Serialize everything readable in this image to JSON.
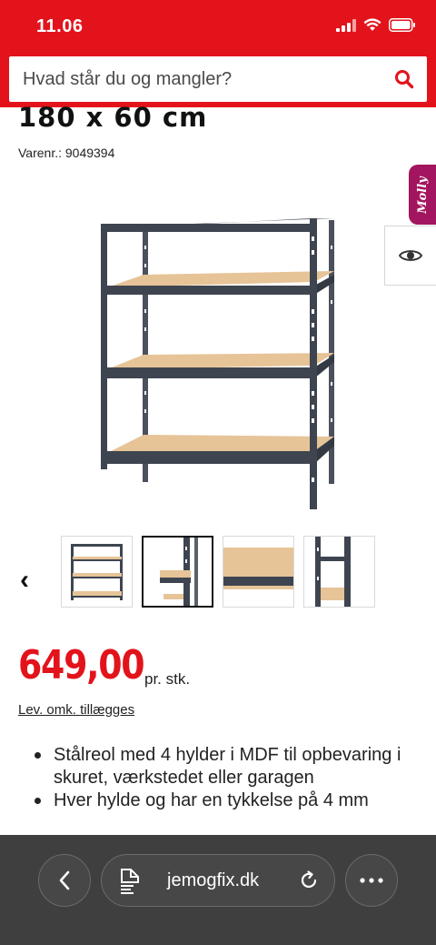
{
  "status_bar": {
    "time": "11.06"
  },
  "search": {
    "placeholder": "Hvad står du og mangler?"
  },
  "product": {
    "title": "180 x 60 cm",
    "sku": "Varenr.: 9049394",
    "price": "649,00",
    "unit": "pr. stk.",
    "delivery_link": "Lev. omk. tillægges",
    "features": [
      "Stålreol med 4 hylder i MDF til opbevaring i skuret, værkstedet eller garagen",
      "Hver hylde og har en tykkelse på 4 mm"
    ]
  },
  "molly_label": "Molly",
  "gallery": {
    "prev_label": "‹",
    "thumbnails": [
      "full-shelf",
      "corner-closeup",
      "shelf-board",
      "upright-closeup"
    ],
    "active_index": 1
  },
  "browser": {
    "url": "jemogfix.dk"
  },
  "colors": {
    "brand_red": "#e3131b",
    "molly_magenta": "#a3155e",
    "frame_gray": "#3e4550",
    "board_tan": "#e6c498",
    "browser_bar": "#3f3f3f"
  },
  "icons": [
    "signal-icon",
    "wifi-icon",
    "battery-icon",
    "search-icon",
    "eye-icon",
    "chevron-left-icon",
    "page-icon",
    "reload-icon",
    "more-icon"
  ]
}
